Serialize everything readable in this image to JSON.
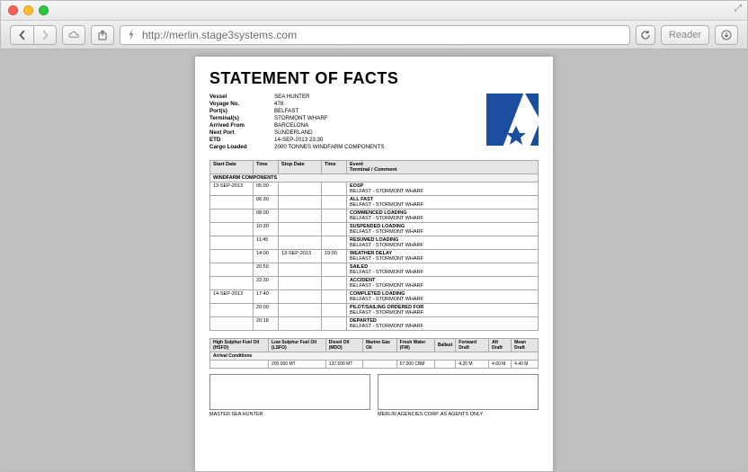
{
  "browser": {
    "url": "http://merlin.stage3systems.com",
    "reader": "Reader"
  },
  "doc": {
    "title": "STATEMENT OF FACTS",
    "meta": [
      {
        "label": "Vessel",
        "val": "SEA HUNTER"
      },
      {
        "label": "Voyage No.",
        "val": "478"
      },
      {
        "label": "Port(s)",
        "val": "BELFAST"
      },
      {
        "label": "Terminal(s)",
        "val": "STORMONT WHARF"
      },
      {
        "label": "Arrived From",
        "val": "BARCELONA"
      },
      {
        "label": "Next Port",
        "val": "SUNDERLAND"
      },
      {
        "label": "ETD",
        "val": "14-SEP-2013 23:30"
      },
      {
        "label": "Cargo Loaded",
        "val": "2000 TONNES WINDFARM COMPONENTS"
      }
    ],
    "events_headers": [
      "Start Date",
      "Time",
      "Stop Date",
      "Time",
      "Event\nTerminal / Comment"
    ],
    "section": "WINDFARM COMPONENTS",
    "events": [
      {
        "sd": "13-SEP-2013",
        "st": "05:00",
        "ed": "",
        "et": "",
        "ev": "EOSP",
        "sub": "BELFAST - STORMONT WHARF"
      },
      {
        "sd": "",
        "st": "06:30",
        "ed": "",
        "et": "",
        "ev": "ALL FAST",
        "sub": "BELFAST - STORMONT WHARF"
      },
      {
        "sd": "",
        "st": "08:00",
        "ed": "",
        "et": "",
        "ev": "COMMENCED LOADING",
        "sub": "BELFAST - STORMONT WHARF"
      },
      {
        "sd": "",
        "st": "10:30",
        "ed": "",
        "et": "",
        "ev": "SUSPENDED LOADING",
        "sub": "BELFAST - STORMONT WHARF"
      },
      {
        "sd": "",
        "st": "11:45",
        "ed": "",
        "et": "",
        "ev": "RESUMED LOADING",
        "sub": "BELFAST - STORMONT WHARF"
      },
      {
        "sd": "",
        "st": "14:00",
        "ed": "13-SEP-2013",
        "et": "19:00",
        "ev": "WEATHER DELAY",
        "sub": "BELFAST - STORMONT WHARF"
      },
      {
        "sd": "",
        "st": "20:50",
        "ed": "",
        "et": "",
        "ev": "SAILED",
        "sub": "BELFAST - STORMONT WHARF"
      },
      {
        "sd": "",
        "st": "22:30",
        "ed": "",
        "et": "",
        "ev": "ACCIDENT",
        "sub": "BELFAST - STORMONT WHARF"
      },
      {
        "sd": "14-SEP-2013",
        "st": "17:40",
        "ed": "",
        "et": "",
        "ev": "COMPLETED LOADING",
        "sub": "BELFAST - STORMONT WHARF"
      },
      {
        "sd": "",
        "st": "20:00",
        "ed": "",
        "et": "",
        "ev": "PILOT/SAILING ORDERED FOR",
        "sub": "BELFAST - STORMONT WHARF"
      },
      {
        "sd": "",
        "st": "20:18",
        "ed": "",
        "et": "",
        "ev": "DEPARTED",
        "sub": "BELFAST - STORMONT WHARF"
      }
    ],
    "res_headers": [
      "High Sulphur Fuel Oil (HSFO)",
      "Low Sulphur Fuel Oil (LSFO)",
      "Diesel Oil (MDO)",
      "Marine Gas Oil",
      "Fresh Water (FW)",
      "Ballast",
      "Forward Draft",
      "Aft Draft",
      "Mean Draft"
    ],
    "res_section": "Arrival Conditions",
    "res_values": [
      "",
      "200.000 MT",
      "137.500 MT",
      "",
      "57.000 CBM",
      "",
      "4.20 M",
      "4.60 M",
      "4.40 M"
    ],
    "sig_left": "MASTER SEA HUNTER",
    "sig_right": "MERLIN AGENCIES CORP. AS AGENTS ONLY"
  }
}
